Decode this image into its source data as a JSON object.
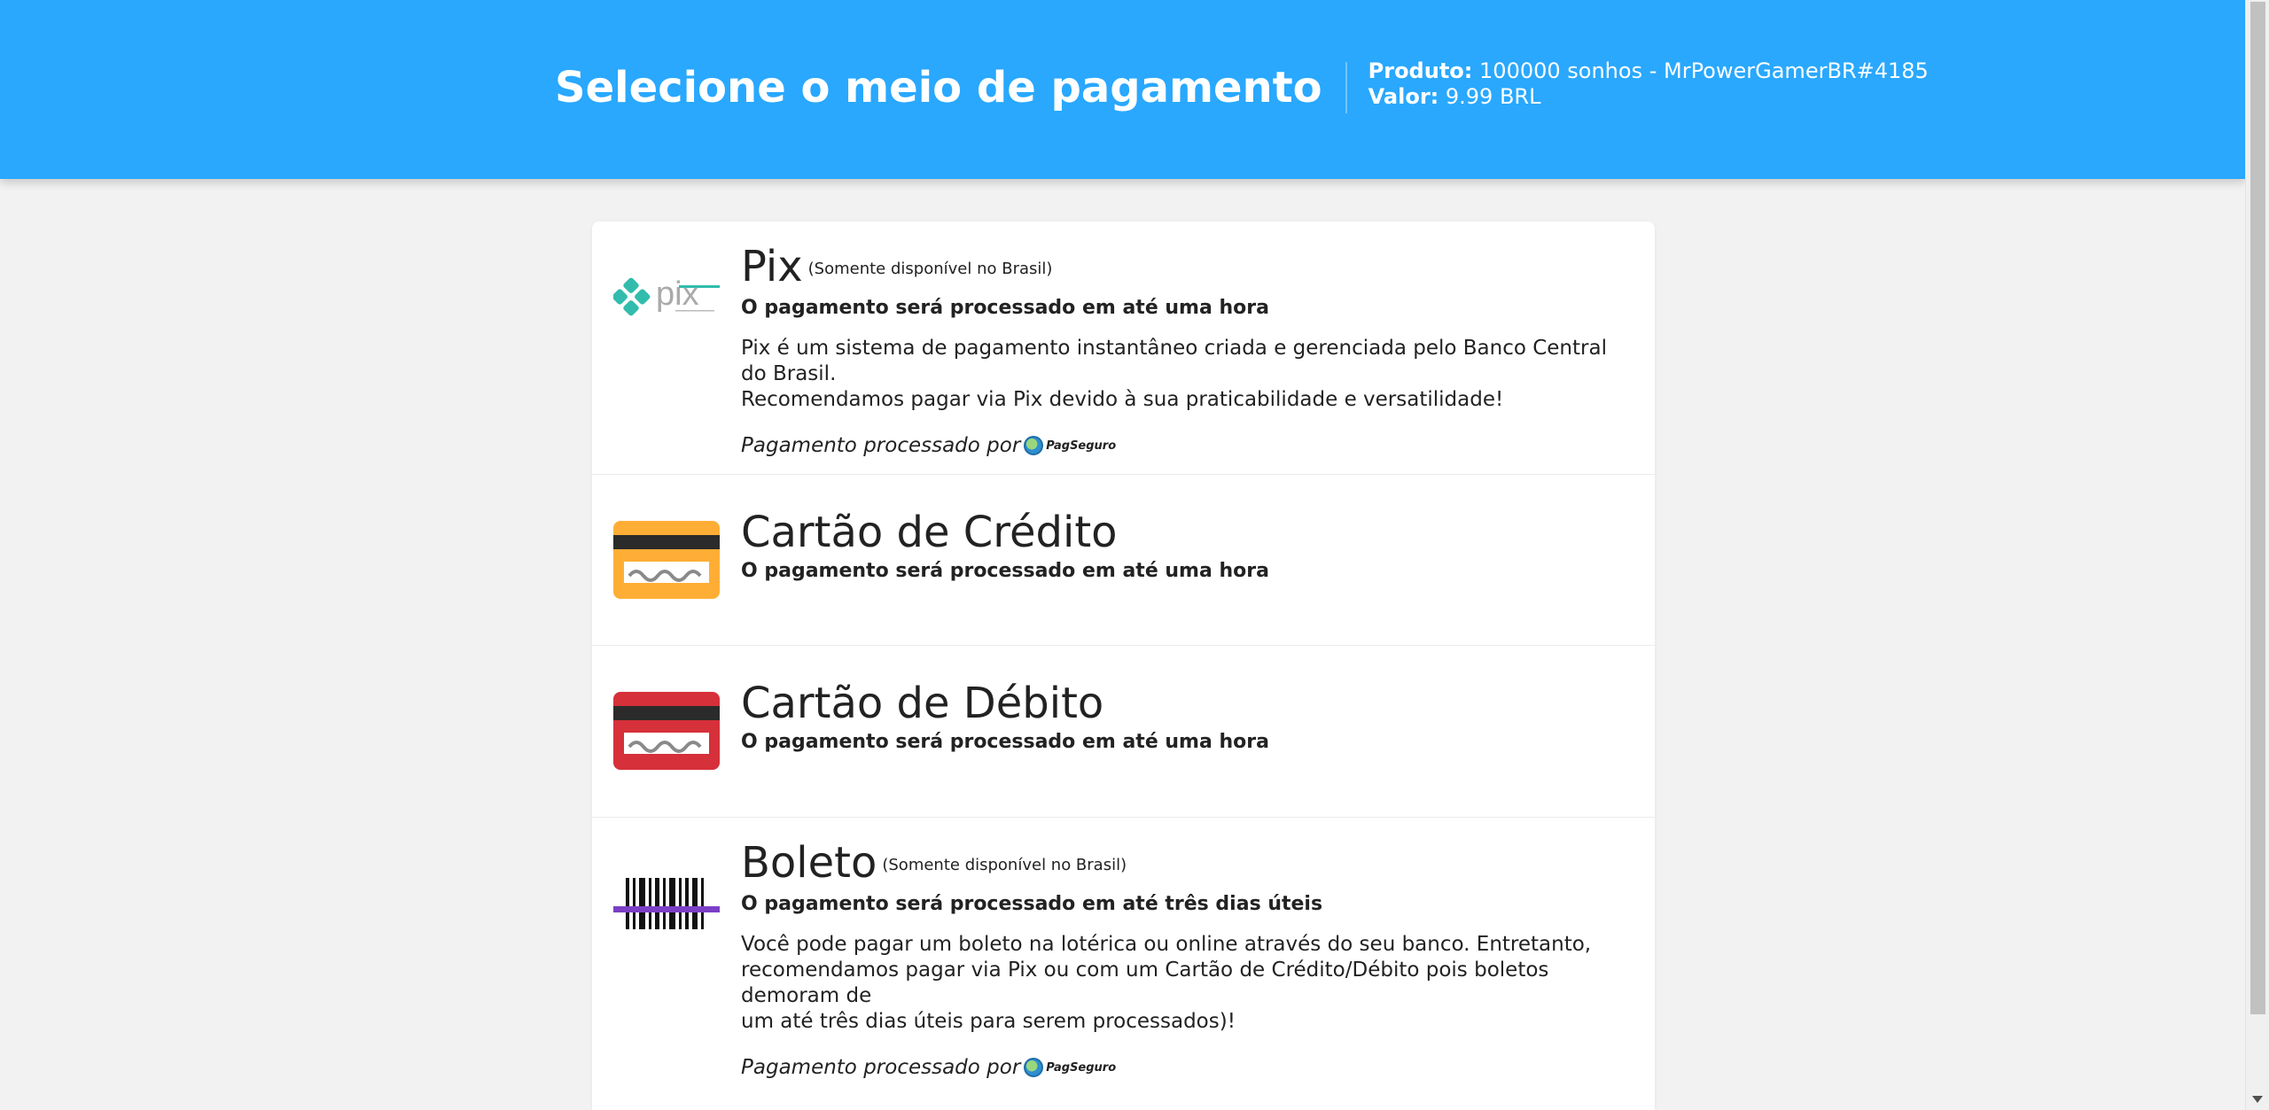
{
  "header": {
    "title": "Selecione o meio de pagamento",
    "product_label": "Produto:",
    "product_value": "100000 sonhos - MrPowerGamerBR#4185",
    "price_label": "Valor:",
    "price_value": "9.99 BRL"
  },
  "methods": [
    {
      "title": "Pix",
      "note": "(Somente disponível no Brasil)",
      "time": "O pagamento será processado em até uma hora",
      "description_lines": [
        "Pix é um sistema de pagamento instantâneo criada e gerenciada pelo Banco Central do Brasil.",
        "Recomendamos pagar via Pix devido à sua praticabilidade e versatilidade!"
      ],
      "processor_text": "Pagamento processado por",
      "processor_name": "PagSeguro",
      "icon": "pix-logo-icon"
    },
    {
      "title": "Cartão de Crédito",
      "time": "O pagamento será processado em até uma hora",
      "icon": "credit-card-icon",
      "color": "#ffae35"
    },
    {
      "title": "Cartão de Débito",
      "time": "O pagamento será processado em até uma hora",
      "icon": "debit-card-icon",
      "color": "#d6303a"
    },
    {
      "title": "Boleto",
      "note": "(Somente disponível no Brasil)",
      "time": "O pagamento será processado em até três dias úteis",
      "description_lines": [
        "Você pode pagar um boleto na lotérica ou online através do seu banco. Entretanto,",
        "recomendamos pagar via Pix ou com um Cartão de Crédito/Débito pois boletos demoram de",
        "um até três dias úteis para serem processados)!"
      ],
      "processor_text": "Pagamento processado por",
      "processor_name": "PagSeguro",
      "icon": "barcode-icon"
    }
  ],
  "colors": {
    "header_bg": "#29a8fe",
    "page_bg": "#f2f2f2",
    "barcode_accent": "#7b3fc6",
    "pix_teal": "#32bcad"
  }
}
